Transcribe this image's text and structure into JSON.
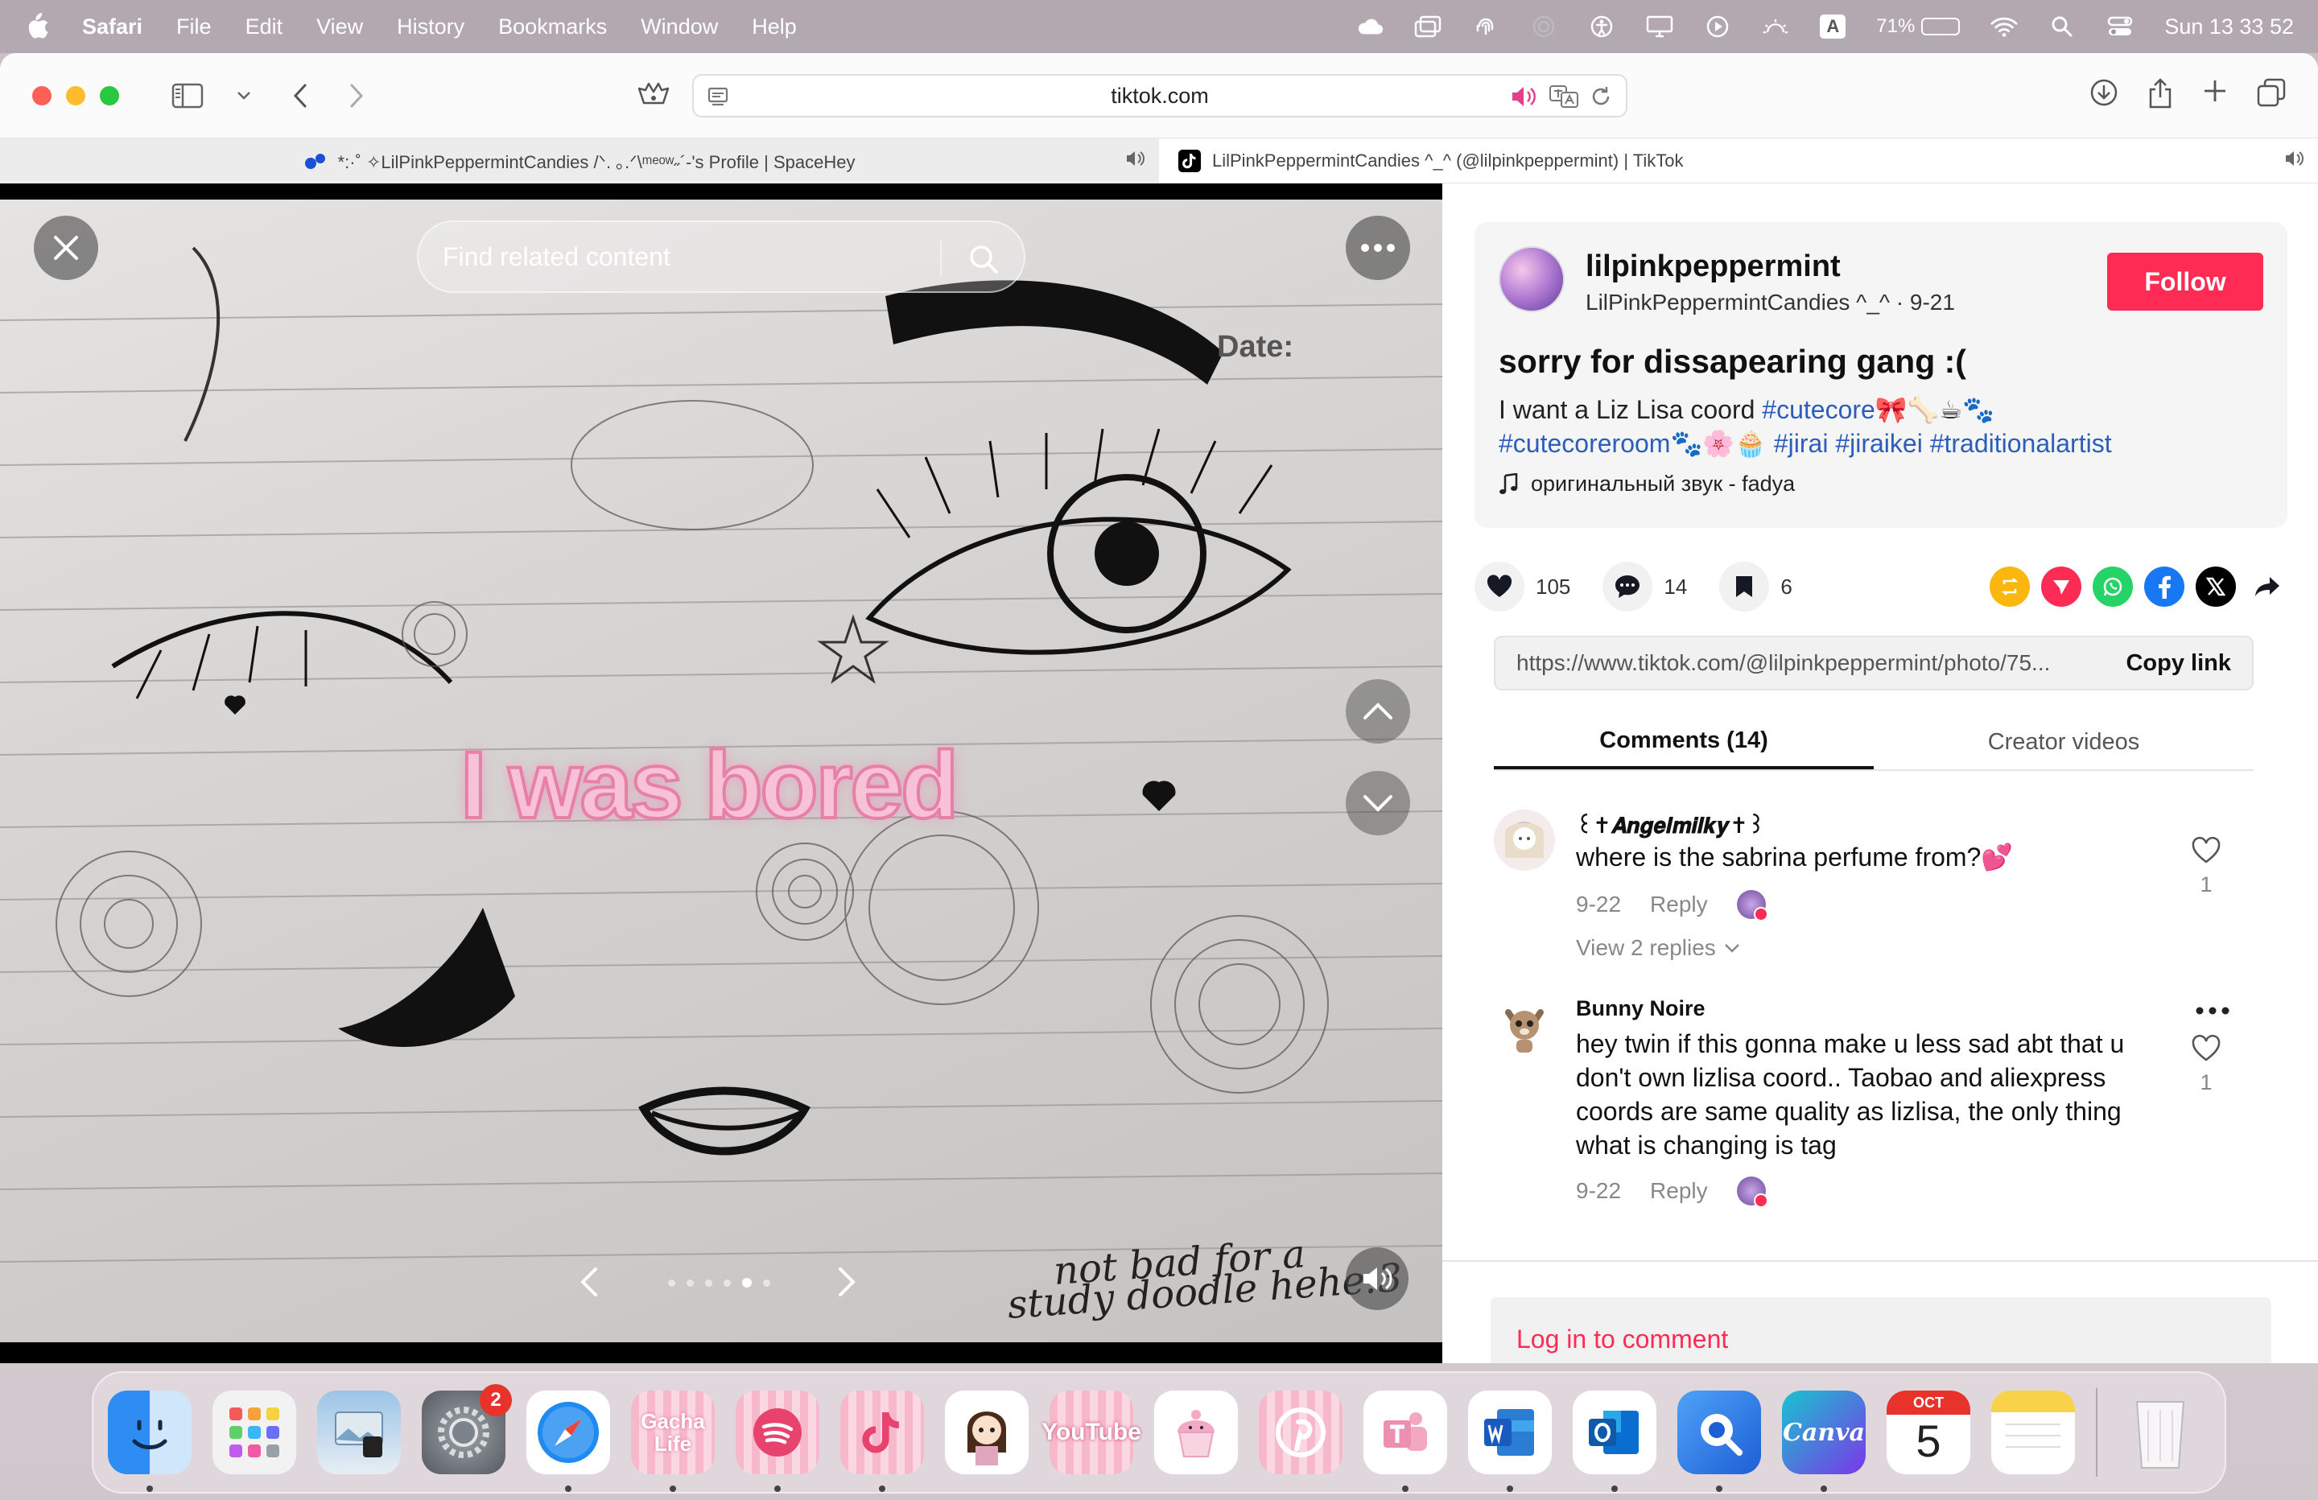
{
  "menubar": {
    "app_name": "Safari",
    "items": [
      "File",
      "Edit",
      "View",
      "History",
      "Bookmarks",
      "Window",
      "Help"
    ],
    "keyboard_badge": "A",
    "battery": "71%",
    "battery_level": 0.71,
    "clock": "Sun 13 33 52"
  },
  "safari": {
    "address": "tiktok.com",
    "tabs": [
      {
        "title": "*:·˚ ✧LilPinkPeppermintCandies /ᐠ. ｡.ᐟ\\ᵐᵉᵒʷ˶´-'s Profile | SpaceHey",
        "active": false
      },
      {
        "title": "LilPinkPeppermintCandies ^_^ (@lilpinkpeppermint) | TikTok",
        "active": true
      }
    ]
  },
  "viewer": {
    "search_placeholder": "Find related content",
    "overlay_text": "I was bored",
    "paper_label": "Date:",
    "handwriting_line1": "not bad for a",
    "handwriting_line2": "study doodle hehe:3",
    "carousel_total": 6,
    "carousel_active": 5
  },
  "post": {
    "username": "lilpinkpeppermint",
    "display_name": "LilPinkPeppermintCandies ^_^ · 9-21",
    "follow_label": "Follow",
    "title": "sorry for dissapearing gang :(",
    "caption_plain": "I want a Liz Lisa coord ",
    "tag1": "#cutecore",
    "emoji1": "🎀🦴☕🐾",
    "tag2": "#cutecoreroom",
    "emoji2": "🐾🌸🧁",
    "tag3": "#jirai",
    "tag4": "#jiraikei",
    "tag5": "#traditionalartist",
    "sound": "оригинальный звук - fadya",
    "likes": "105",
    "comments_count": "14",
    "saves": "6",
    "link": "https://www.tiktok.com/@lilpinkpeppermint/photo/75...",
    "copy_link_label": "Copy link",
    "tab_comments": "Comments (14)",
    "tab_creator": "Creator videos"
  },
  "comments": [
    {
      "name": "꒰✝𝑨𝒏𝒈𝒆𝒍𝒎𝒊𝒍𝒌𝒚✝꒱",
      "text": "where is the sabrina perfume from?💕",
      "date": "9-22",
      "reply": "Reply",
      "likes": "1",
      "view_replies": "View 2 replies"
    },
    {
      "name": "Bunny Noire",
      "text": "hey twin if this gonna make u less sad abt that u don't own lizlisa coord.. Taobao and aliexpress coords are same quality as lizlisa, the only thing what is changing is tag",
      "date": "9-22",
      "reply": "Reply",
      "likes": "1"
    }
  ],
  "login": {
    "label": "Log in to comment"
  },
  "dock": {
    "settings_badge": "2",
    "gacha_label": "Gacha Life",
    "youtube_label": "YouTube",
    "canva_label": "Canva",
    "calendar_month": "OCT",
    "calendar_day": "5"
  }
}
